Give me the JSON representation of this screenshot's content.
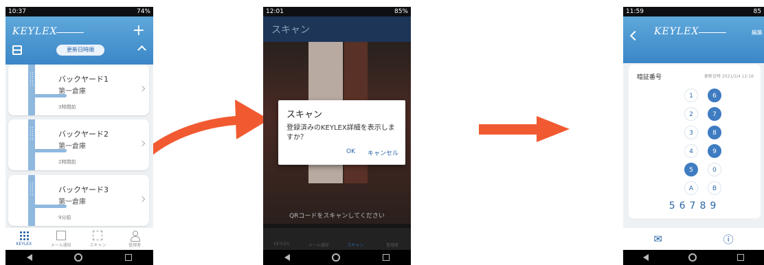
{
  "phone1": {
    "status": {
      "time": "10:37",
      "battery": "74%"
    },
    "header": {
      "logo": "KEYLEX",
      "sort_label": "更新日時順"
    },
    "cards": [
      {
        "name": "バックヤード1",
        "location": "第一倉庫",
        "time": "3時間前"
      },
      {
        "name": "バックヤード2",
        "location": "第一倉庫",
        "time": "2時間前"
      },
      {
        "name": "バックヤード3",
        "location": "第一倉庫",
        "time": "9分前"
      }
    ],
    "tabs": [
      "KEYLEX",
      "メール通知",
      "スキャン",
      "管理者"
    ]
  },
  "phone2": {
    "status": {
      "time": "12:01",
      "battery": "85%"
    },
    "header": {
      "title": "スキャン"
    },
    "dialog": {
      "title": "スキャン",
      "message": "登録済みのKEYLEX詳細を表示しますか？",
      "ok": "OK",
      "cancel": "キャンセル"
    },
    "scan_text": "QRコードをスキャンしてください",
    "tabs": [
      "KEYLEX",
      "メール通知",
      "スキャン",
      "管理者"
    ]
  },
  "phone3": {
    "status": {
      "time": "11:59",
      "battery": "85"
    },
    "header": {
      "logo": "KEYLEX",
      "edit": "編集"
    },
    "panel": {
      "label": "暗証番号",
      "updated": "更新日時 2021/2/4 12:16"
    },
    "keys": [
      {
        "label": "1",
        "selected": false
      },
      {
        "label": "6",
        "selected": true
      },
      {
        "label": "2",
        "selected": false
      },
      {
        "label": "7",
        "selected": true
      },
      {
        "label": "3",
        "selected": false
      },
      {
        "label": "8",
        "selected": true
      },
      {
        "label": "4",
        "selected": false
      },
      {
        "label": "9",
        "selected": true
      },
      {
        "label": "5",
        "selected": true
      },
      {
        "label": "0",
        "selected": false
      },
      {
        "label": "A",
        "selected": false
      },
      {
        "label": "B",
        "selected": false
      }
    ],
    "code": "56789"
  },
  "colors": {
    "accent": "#f15a31",
    "brand": "#3b86c7"
  }
}
